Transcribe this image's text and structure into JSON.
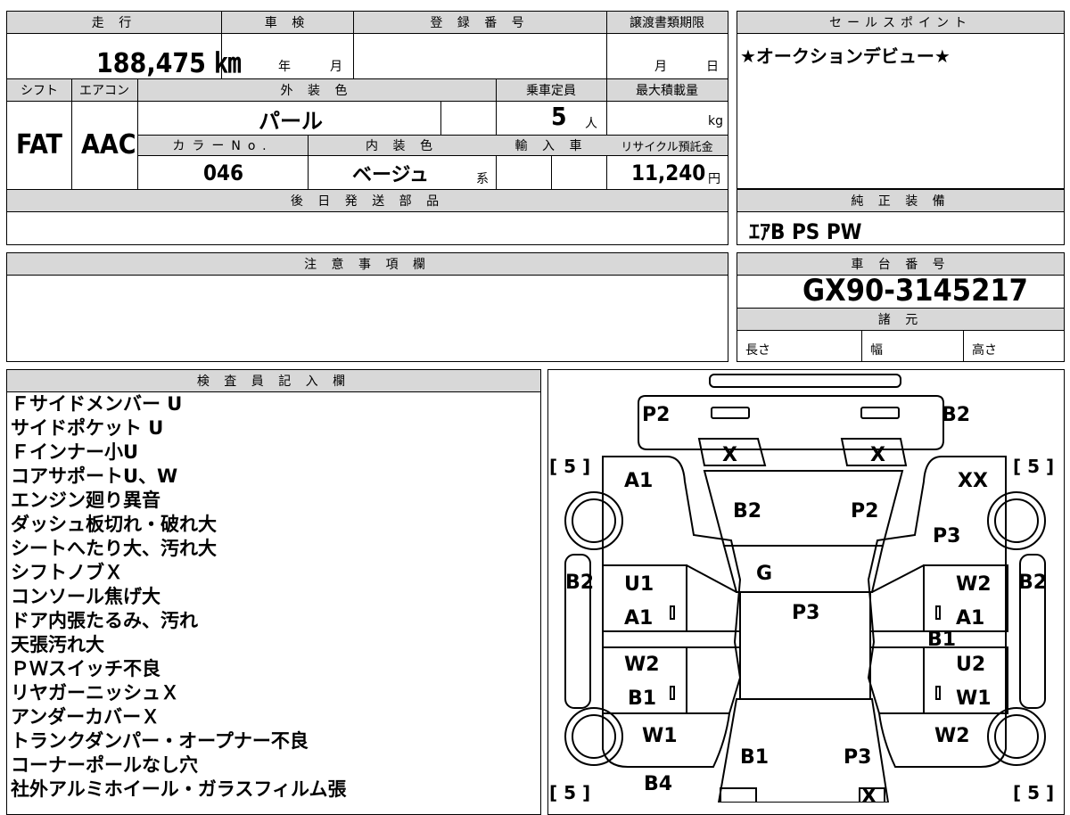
{
  "specs": {
    "mileage_header": "走 行",
    "mileage": "188,475 ㎞",
    "shaken_header": "車 検",
    "shaken_year": "年",
    "shaken_month": "月",
    "registration_header": "登 録 番 号",
    "transfer_header": "譲渡書類期限",
    "transfer_month": "月",
    "transfer_day": "日",
    "shift_header": "シフト",
    "shift": "FAT",
    "ac_header": "エアコン",
    "ac": "AAC",
    "exterior_header": "外 装 色",
    "exterior": "パール",
    "capacity_header": "乗車定員",
    "capacity": "5",
    "capacity_unit": "人",
    "load_header": "最大積載量",
    "load_unit": "kg",
    "color_no_header": "カラーNo.",
    "color_no": "046",
    "interior_header": "内 装 色",
    "interior": "ベージュ",
    "interior_suffix": "系",
    "import_header": "輸 入 車",
    "recycle_header": "リサイクル預託金",
    "recycle": "11,240",
    "recycle_unit": "円",
    "later_parts_header": "後 日 発 送 部 品"
  },
  "sales": {
    "header": "セールスポイント",
    "text": "★オークションデビュー★"
  },
  "equipment": {
    "header": "純 正 装 備",
    "text": "ｴｱB PS PW"
  },
  "caution": {
    "header": "注 意 事 項 欄"
  },
  "chassis": {
    "header": "車 台 番 号",
    "number": "GX90-3145217",
    "dims_header": "諸 元",
    "length": "長さ",
    "width": "幅",
    "height": "高さ"
  },
  "inspector": {
    "header": "検 査 員 記 入 欄",
    "notes": [
      "Ｆサイドメンバー U",
      "サイドポケット U",
      "Ｆインナー小U",
      "コアサポートU、W",
      "エンジン廻り異音",
      "ダッシュ板切れ・破れ大",
      "シートへたり大、汚れ大",
      "シフトノブＸ",
      "コンソール焦げ大",
      "ドア内張たるみ、汚れ",
      "天張汚れ大",
      "ＰＷスイッチ不良",
      "リヤガーニッシュＸ",
      "アンダーカバーＸ",
      "トランクダンパー・オープナー不良",
      "コーナーポールなし穴",
      "社外アルミホイール・ガラスフィルム張"
    ]
  },
  "diagram": {
    "marks": [
      "P2",
      "B2",
      "X",
      "X",
      "[ 5 ]",
      "[ 5 ]",
      "A1",
      "XX",
      "B2",
      "P2",
      "P3",
      "G",
      "B2",
      "B2",
      "U1",
      "W2",
      "P3",
      "A1",
      "A1",
      "B1",
      "W2",
      "U2",
      "B1",
      "W1",
      "W1",
      "W2",
      "B1",
      "P3",
      "B4",
      "[ 5 ]",
      "[ 5 ]",
      "X"
    ]
  }
}
